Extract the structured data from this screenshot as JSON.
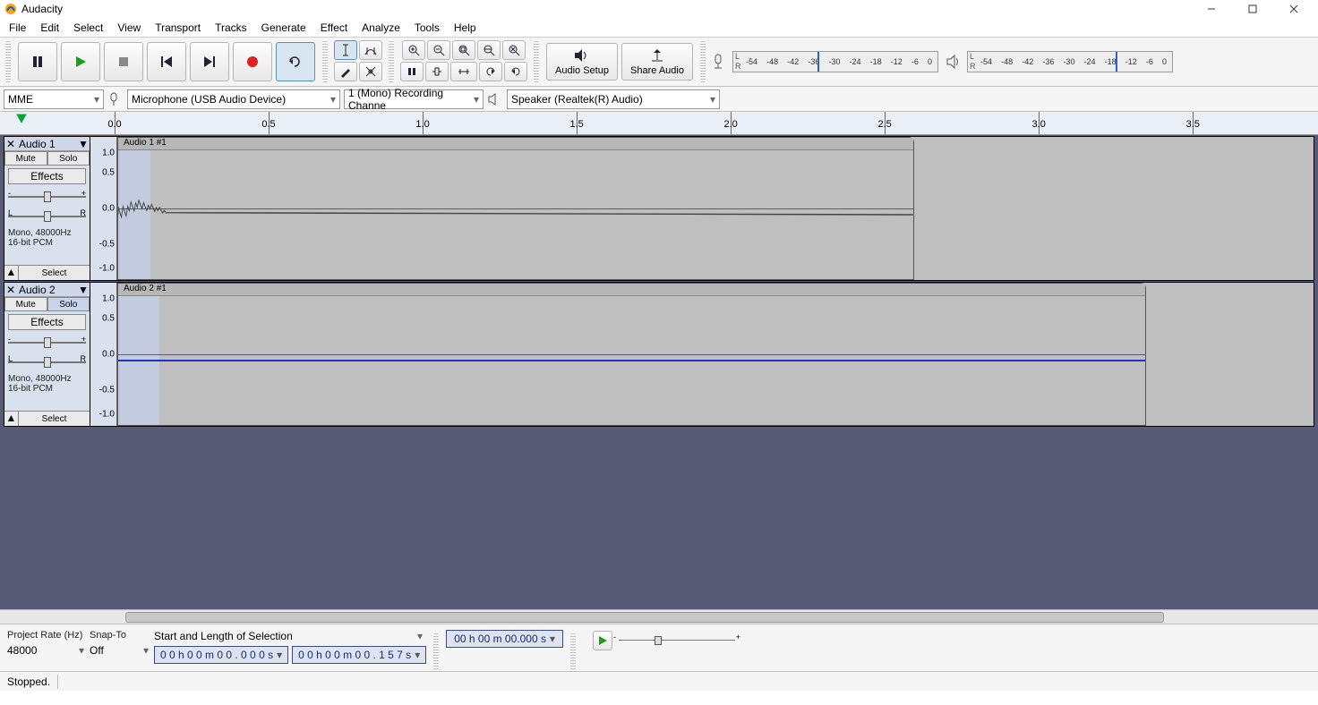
{
  "app": {
    "title": "Audacity"
  },
  "window_controls": {
    "min": "–",
    "max": "❐",
    "close": "✕"
  },
  "menu": {
    "items": [
      "File",
      "Edit",
      "Select",
      "View",
      "Transport",
      "Tracks",
      "Generate",
      "Effect",
      "Analyze",
      "Tools",
      "Help"
    ]
  },
  "transport": {
    "pause": "pause",
    "play": "play",
    "stop": "stop",
    "skip_start": "skip-start",
    "skip_end": "skip-end",
    "record": "record",
    "loop": "loop"
  },
  "tooltools": {
    "row1": [
      "selection-tool",
      "envelope-tool"
    ],
    "row2": [
      "draw-tool",
      "multi-tool"
    ]
  },
  "edit_tools": {
    "row1": [
      "zoom-in",
      "zoom-out",
      "fit-selection",
      "fit-project",
      "zoom-toggle"
    ],
    "row2": [
      "trim",
      "silence",
      "undo",
      "redo"
    ]
  },
  "setup": {
    "audio_setup": "Audio Setup",
    "share_audio": "Share Audio"
  },
  "meters": {
    "rec": {
      "labels": [
        "-54",
        "-48",
        "-42",
        "-36",
        "-30",
        "-24",
        "-18",
        "-12",
        "-6",
        "0"
      ],
      "marker_pct": 38
    },
    "play": {
      "labels": [
        "-54",
        "-48",
        "-42",
        "-36",
        "-30",
        "-24",
        "-18",
        "-12",
        "-6",
        "0"
      ],
      "marker_pct": 72
    }
  },
  "devices": {
    "host": "MME",
    "input": "Microphone (USB Audio Device)",
    "channels": "1 (Mono) Recording Channe",
    "output": "Speaker (Realtek(R) Audio)"
  },
  "timeline": {
    "ticks": [
      {
        "label": "0.0",
        "pct": 0
      },
      {
        "label": "0.5",
        "pct": 12.8
      },
      {
        "label": "1.0",
        "pct": 25.6
      },
      {
        "label": "1.5",
        "pct": 38.4
      },
      {
        "label": "2.0",
        "pct": 51.2
      },
      {
        "label": "2.5",
        "pct": 64.0
      },
      {
        "label": "3.0",
        "pct": 76.8
      },
      {
        "label": "3.5",
        "pct": 89.6
      }
    ]
  },
  "tracks": [
    {
      "name": "Audio 1",
      "clip_title": "Audio 1 #1",
      "mute": "Mute",
      "solo": "Solo",
      "solo_active": false,
      "effects": "Effects",
      "gain_minus": "-",
      "gain_plus": "+",
      "pan_l": "L",
      "pan_r": "R",
      "info1": "Mono, 48000Hz",
      "info2": "16-bit PCM",
      "select": "Select",
      "collapse": "▲",
      "vscale": [
        "1.0",
        "0.5",
        "0.0",
        "-0.5",
        "-1.0"
      ],
      "clip_width_pct": 66.6,
      "sel_width_pct": 4.0,
      "wave": "noise"
    },
    {
      "name": "Audio 2",
      "clip_title": "Audio 2 #1",
      "mute": "Mute",
      "solo": "Solo",
      "solo_active": true,
      "effects": "Effects",
      "gain_minus": "-",
      "gain_plus": "+",
      "pan_l": "L",
      "pan_r": "R",
      "info1": "Mono, 48000Hz",
      "info2": "16-bit PCM",
      "select": "Select",
      "collapse": "▲",
      "vscale": [
        "1.0",
        "0.5",
        "0.0",
        "-0.5",
        "-1.0"
      ],
      "clip_width_pct": 86.0,
      "sel_width_pct": 4.0,
      "wave": "flat"
    }
  ],
  "selection_bar": {
    "project_rate_label": "Project Rate (Hz)",
    "project_rate": "48000",
    "snap_label": "Snap-To",
    "snap": "Off",
    "mode": "Start and Length of Selection",
    "time1": "0 0 h 0 0 m 0 0 . 0 0 0 s",
    "time2": "0 0 h 0 0 m 0 0 . 1 5 7 s",
    "bigtime": "00 h 00 m 00.000 s"
  },
  "status": {
    "text": "Stopped."
  }
}
